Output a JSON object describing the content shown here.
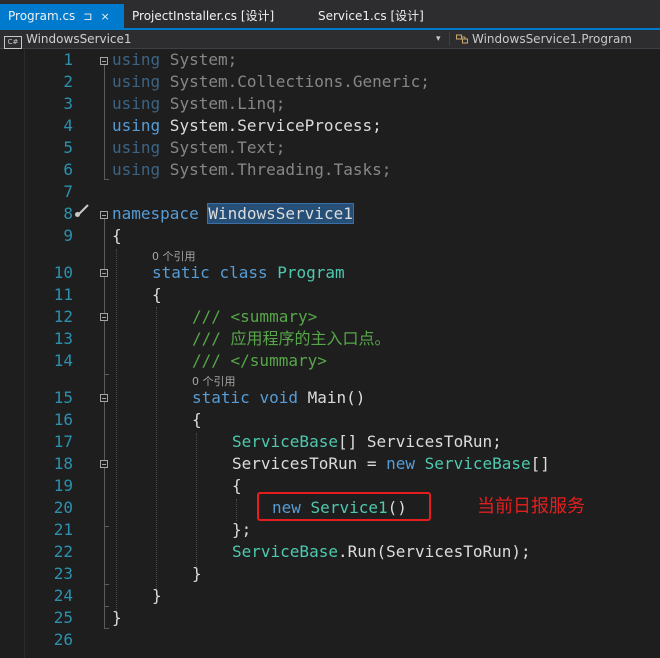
{
  "tabs": [
    {
      "label": "Program.cs",
      "active": true,
      "pin": "⊐",
      "close": "×"
    },
    {
      "label": "ProjectInstaller.cs [设计]"
    },
    {
      "label": "Service1.cs [设计]"
    }
  ],
  "navbar": {
    "project_icon": "C#",
    "project": "WindowsService1",
    "class_path": "WindowsService1.Program"
  },
  "icons": {
    "pin": "pin-icon",
    "close": "close-icon",
    "csharp": "csharp-project-icon",
    "dropdown": "chevron-down-icon",
    "class": "class-icon",
    "fold": "fold-toggle-icon",
    "quick_action": "brush-icon"
  },
  "editor": {
    "line_numbers": [
      "1",
      "2",
      "3",
      "4",
      "5",
      "6",
      "7",
      "8",
      "9",
      "10",
      "11",
      "12",
      "13",
      "14",
      "15",
      "16",
      "17",
      "18",
      "19",
      "20",
      "21",
      "22",
      "23",
      "24",
      "25",
      "26"
    ],
    "codelens_refs": "0 个引用",
    "lines": {
      "l1": {
        "kw": "using",
        "rest": " System;"
      },
      "l2": {
        "kw": "using",
        "rest": " System.Collections.Generic;"
      },
      "l3": {
        "kw": "using",
        "rest": " System.Linq;"
      },
      "l4": {
        "kw": "using",
        "rest": " System.ServiceProcess;"
      },
      "l5": {
        "kw": "using",
        "rest": " System.Text;"
      },
      "l6": {
        "kw": "using",
        "rest": " System.Threading.Tasks;"
      },
      "l8": {
        "kw": "namespace",
        "name": "WindowsService1"
      },
      "l9": "{",
      "l10": {
        "kw1": "static",
        "kw2": "class",
        "type": "Program"
      },
      "l11": "{",
      "l12": "/// <summary>",
      "l13": "/// 应用程序的主入口点。",
      "l14": "/// </summary>",
      "l15": {
        "kw1": "static",
        "kw2": "void",
        "name": "Main()"
      },
      "l16": "{",
      "l17": {
        "type": "ServiceBase",
        "rest": "[] ServicesToRun;"
      },
      "l18": {
        "var": "ServicesToRun = ",
        "kw": "new",
        "type": "ServiceBase",
        "rest": "[]"
      },
      "l19": "{",
      "l20": {
        "kw": "new",
        "type": "Service1",
        "rest": "()"
      },
      "l21": "};",
      "l22": {
        "type": "ServiceBase",
        "rest": ".Run(ServicesToRun);"
      },
      "l23": "}",
      "l24": "}",
      "l25": "}"
    }
  },
  "annotation": {
    "text": "当前日报服务",
    "color": "#e41e1e"
  },
  "colors": {
    "keyword": "#569cd6",
    "type": "#4ec9b0",
    "comment": "#57a64a",
    "line_number": "#2b91af",
    "accent": "#007acc",
    "background": "#1e1e1e"
  }
}
